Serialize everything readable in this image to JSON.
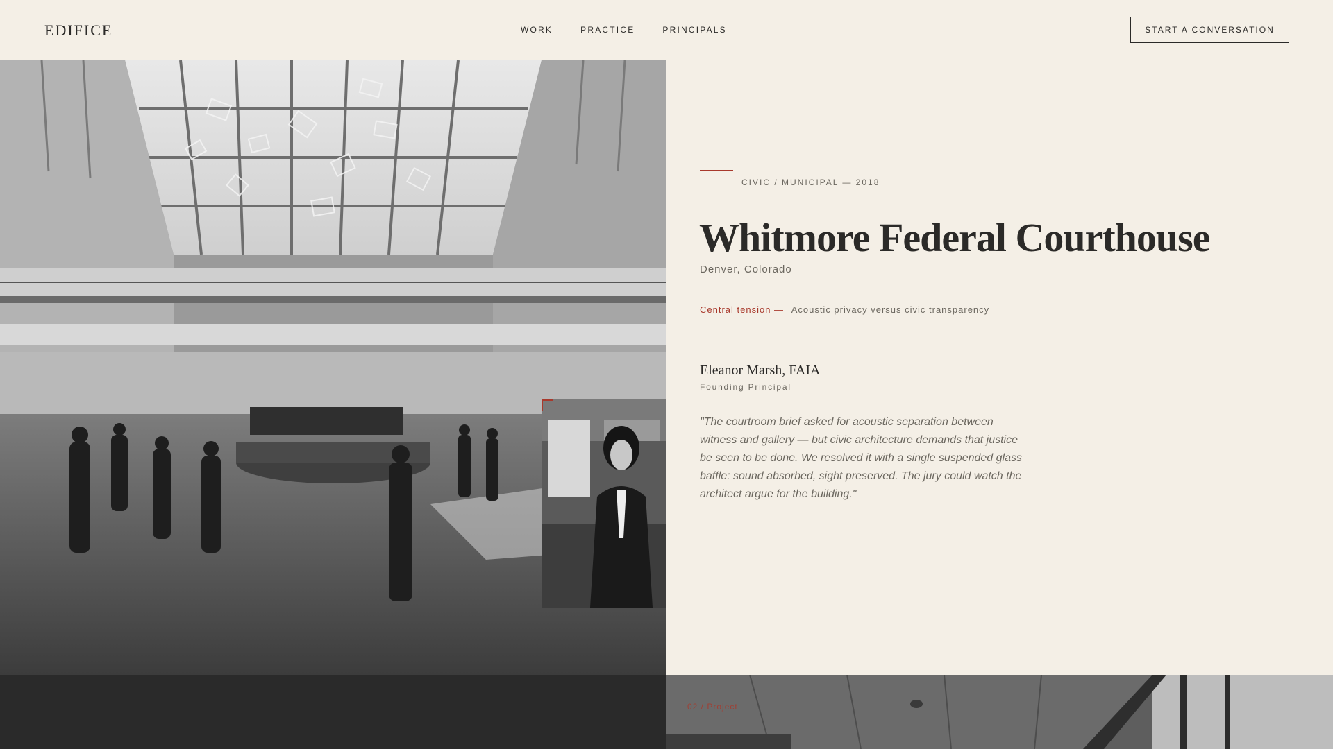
{
  "header": {
    "logo": "EDIFICE",
    "nav": [
      "WORK",
      "PRACTICE",
      "PRINCIPALS"
    ],
    "cta_label": "START A CONVERSATION"
  },
  "project": {
    "category": "CIVIC / MUNICIPAL — 2018",
    "title": "Whitmore Federal Courthouse",
    "location": "Denver, Colorado",
    "tension_label": "Central tension —",
    "tension_text": "Acoustic privacy versus civic transparency"
  },
  "principal": {
    "name": "Eleanor Marsh, FAIA",
    "role": "Founding Principal",
    "quote": "\"The courtroom brief asked for acoustic separation between witness and gallery — but civic architecture demands that justice be seen to be done. We resolved it with a single suspended glass baffle: sound absorbed, sight preserved. The jury could watch the architect argue for the building.\""
  },
  "next": {
    "label": "02 / Project"
  },
  "colors": {
    "background": "#f4efe6",
    "accent": "#a8392c",
    "text": "#2b2a28",
    "muted": "#6b675f",
    "dark": "#2a2a2a"
  }
}
